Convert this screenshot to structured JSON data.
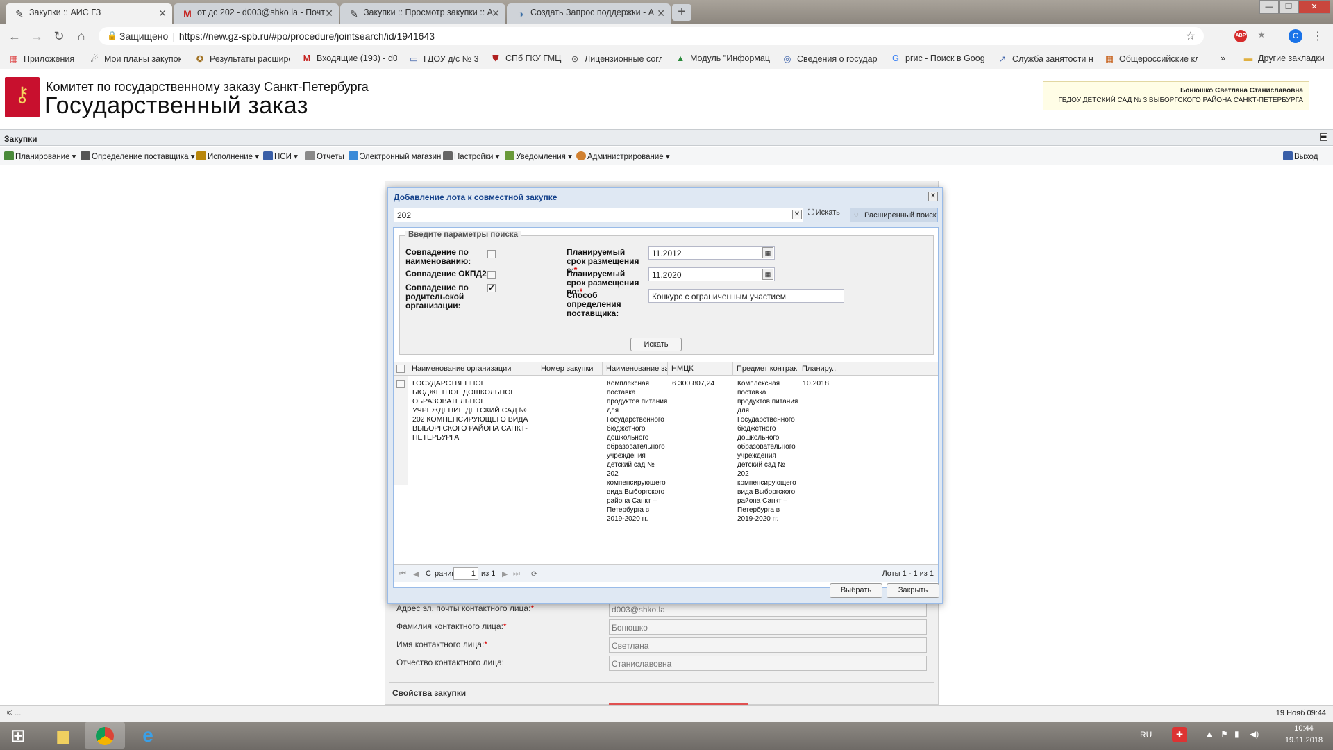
{
  "browser": {
    "tabs": [
      {
        "title": "Закупки :: АИС ГЗ",
        "icon": "✎"
      },
      {
        "title": "от дс 202 - d003@shko.la - Почт",
        "icon": "M"
      },
      {
        "title": "Закупки :: Просмотр закупки :: А",
        "icon": "✎"
      },
      {
        "title": "Создать Запрос поддержки - А",
        "icon": "◑"
      }
    ],
    "secure_label": "Защищено",
    "url": "https://new.gz-spb.ru/#po/procedure/jointsearch/id/1941643",
    "profile_initial": "C",
    "bookmarks": [
      {
        "label": "Приложения",
        "icon": "▦"
      },
      {
        "label": "Мои планы закупок",
        "icon": "☄"
      },
      {
        "label": "Результаты расшире",
        "icon": "✪"
      },
      {
        "label": "Входящие (193) - d0",
        "icon": "M"
      },
      {
        "label": "ГДОУ д/с № 3",
        "icon": "▭"
      },
      {
        "label": "СПб ГКУ ГМЦ",
        "icon": "⛊"
      },
      {
        "label": "Лицензионные согл",
        "icon": "⊙"
      },
      {
        "label": "Модуль \"Информац",
        "icon": "▲"
      },
      {
        "label": "Сведения о государ",
        "icon": "◎"
      },
      {
        "label": "ргис - Поиск в Goog",
        "icon": "G"
      },
      {
        "label": "Служба занятости н",
        "icon": "↗"
      },
      {
        "label": "Общероссийские кл",
        "icon": "▦"
      }
    ],
    "more_bookmarks": "»",
    "other_bookmarks": "Другие закладки"
  },
  "header": {
    "org_line1": "Комитет по государственному заказу Санкт-Петербурга",
    "org_line2": "Государственный заказ",
    "user_name": "Бонюшко Светлана Станиславовна",
    "user_org": "ГБДОУ ДЕТСКИЙ САД № 3 ВЫБОРГСКОГО РАЙОНА САНКТ-ПЕТЕРБУРГА",
    "section": "Закупки"
  },
  "menu": [
    {
      "label": "Планирование",
      "icon": "list",
      "color": "#4a8a3a"
    },
    {
      "label": "Определение поставщика",
      "icon": "gear",
      "color": "#555555"
    },
    {
      "label": "Исполнение",
      "icon": "briefcase",
      "color": "#b8860b"
    },
    {
      "label": "НСИ",
      "icon": "book",
      "color": "#3a5fa8"
    },
    {
      "label": "Отчеты",
      "icon": "report",
      "color": "#8a8a8a"
    },
    {
      "label": "Электронный магазин",
      "icon": "cart",
      "color": "#3a8ad8"
    },
    {
      "label": "Настройки",
      "icon": "wrench",
      "color": "#666666"
    },
    {
      "label": "Уведомления",
      "icon": "mail",
      "color": "#6a9a3a"
    },
    {
      "label": "Администрирование",
      "icon": "user",
      "color": "#d08030"
    }
  ],
  "exit_label": "Выход",
  "background_form": {
    "fields": [
      {
        "label": "Адрес эл. почты контактного лица:",
        "required": true,
        "value": "d003@shko.la"
      },
      {
        "label": "Фамилия контактного лица:",
        "required": true,
        "value": "Бонюшко"
      },
      {
        "label": "Имя контактного лица:",
        "required": true,
        "value": "Светлана"
      },
      {
        "label": "Отчество контактного лица:",
        "required": false,
        "value": "Станиславовна"
      }
    ],
    "properties_legend": "Свойства закупки"
  },
  "dialog": {
    "title": "Добавление лота к совместной закупке",
    "search_value": "202",
    "search_button": "Искать",
    "advanced_button": "Расширенный поиск",
    "params_legend": "Введите параметры поиска",
    "match_name_label": "Совпадение по наименованию:",
    "match_okpd_label": "Совпадение ОКПД2:",
    "match_parent_label": "Совпадение по родительской организации:",
    "match_name_checked": false,
    "match_okpd_checked": false,
    "match_parent_checked": true,
    "period_from_label": "Планируемый срок размещения с:",
    "period_from_value": "11.2012",
    "period_to_label": "Планируемый срок размещения по:",
    "period_to_value": "11.2020",
    "method_label": "Способ определения поставщика:",
    "method_value": "Конкурс с ограниченным участием",
    "find_button": "Искать",
    "columns": [
      "Наименование организации",
      "Номер закупки",
      "Наименование за...",
      "НМЦК",
      "Предмет контракта",
      "Планиру..."
    ],
    "rows": [
      {
        "org": "ГОСУДАРСТВЕННОЕ БЮДЖЕТНОЕ ДОШКОЛЬНОЕ ОБРАЗОВАТЕЛЬНОЕ УЧРЕЖДЕНИЕ ДЕТСКИЙ САД № 202 КОМПЕНСИРУЮЩЕГО ВИДА ВЫБОРГСКОГО РАЙОНА САНКТ-ПЕТЕРБУРГА",
        "number": "",
        "name": "Комплексная поставка продуктов питания для Государственного бюджетного дошкольного образовательного учреждения детский сад № 202 компенсирующего вида Выборгского района Санкт – Петербурга в 2019-2020 гг.",
        "nmck": "6 300 807,24",
        "subject": "Комплексная поставка продуктов питания для Государственного бюджетного дошкольного образовательного учреждения детский сад № 202 компенсирующего вида Выборгского района Санкт – Петербурга в 2019-2020 гг.",
        "planned": "10.2018"
      }
    ],
    "pager": {
      "page_label": "Страница",
      "page": "1",
      "of_label": "из 1",
      "summary": "Лоты 1 - 1 из 1"
    },
    "select_button": "Выбрать",
    "close_button": "Закрыть"
  },
  "status": {
    "left": "© ...",
    "datetime": "19 Нояб 09:44"
  },
  "taskbar": {
    "lang": "RU",
    "time": "10:44",
    "date": "19.11.2018"
  }
}
